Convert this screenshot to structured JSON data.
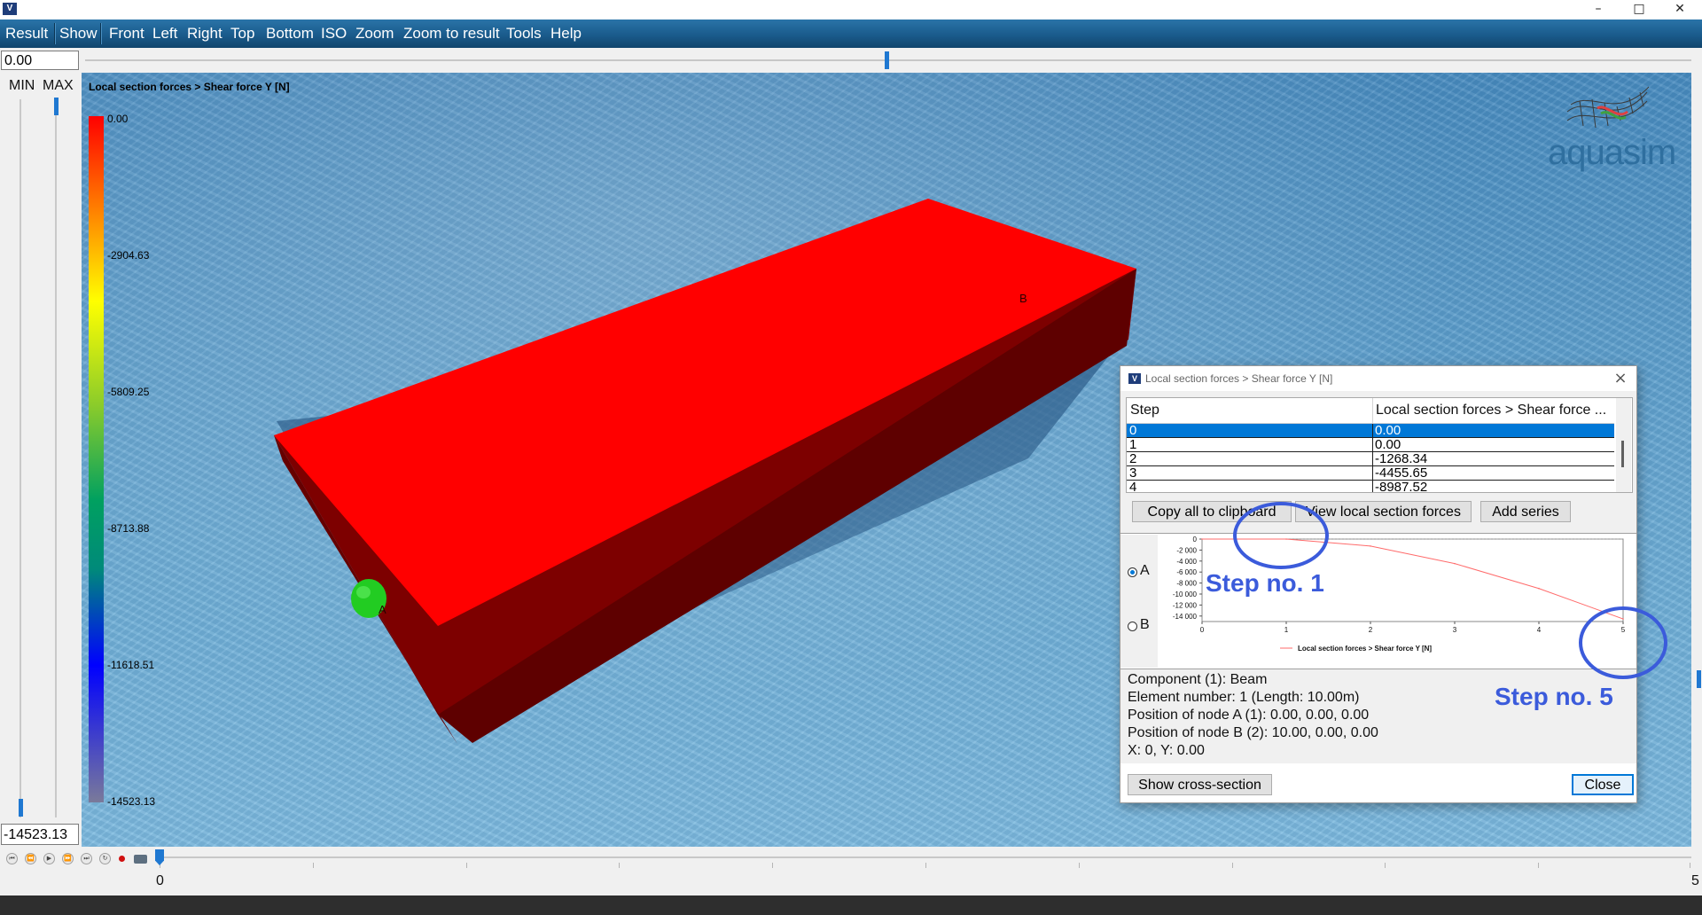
{
  "window": {
    "icon": "aquasim-app-icon",
    "controls": [
      "–",
      "□",
      "✕"
    ]
  },
  "menu": {
    "items": [
      "Result",
      "Show",
      "Front",
      "Left",
      "Right",
      "Top",
      "Bottom",
      "ISO",
      "Zoom",
      "Zoom to result",
      "Tools",
      "Help"
    ]
  },
  "step_value": "0.00",
  "range": {
    "min_label": "MIN",
    "max_label": "MAX",
    "min_value": "-14523.13"
  },
  "legend": {
    "title": "Local section forces > Shear force Y [N]",
    "labels": [
      "0.00",
      "-2904.63",
      "-5809.25",
      "-8713.88",
      "-11618.51",
      "-14523.13"
    ]
  },
  "logo": {
    "text": "aquasim",
    "icon": "aquasim-mesh-logo-icon"
  },
  "scene": {
    "node_a": "A",
    "node_b": "B",
    "beam_color": "#ff0000"
  },
  "timeline": {
    "start": "0",
    "end": "5",
    "controls": [
      "first-icon",
      "prev-icon",
      "play-icon",
      "next-icon",
      "last-icon",
      "loop-icon",
      "record-icon",
      "camera-icon"
    ]
  },
  "dialog": {
    "title": "Local section forces > Shear force Y [N]",
    "table": {
      "headers": [
        "Step",
        "Local section forces > Shear force ..."
      ],
      "rows": [
        [
          "0",
          "0.00"
        ],
        [
          "1",
          "0.00"
        ],
        [
          "2",
          "-1268.34"
        ],
        [
          "3",
          "-4455.65"
        ],
        [
          "4",
          "-8987.52"
        ]
      ]
    },
    "buttons": {
      "copy": "Copy all to clipboard",
      "view": "View local section forces",
      "add": "Add series",
      "cross": "Show cross-section",
      "close": "Close"
    },
    "radios": {
      "a": "A",
      "b": "B"
    },
    "info": [
      "Component (1): Beam",
      "Element number: 1 (Length: 10.00m)",
      "Position of node A (1): 0.00, 0.00, 0.00",
      "Position of node B (2): 10.00, 0.00, 0.00",
      "X: 0, Y: 0.00"
    ]
  },
  "annotations": {
    "step1": "Step no. 1",
    "step5": "Step no. 5",
    "color": "#3b5bdb"
  },
  "chart_data": {
    "type": "line",
    "x": [
      0,
      1,
      2,
      3,
      4,
      5
    ],
    "series": [
      {
        "name": "Local section forces > Shear force Y [N]",
        "values": [
          0,
          0,
          -1268.34,
          -4455.65,
          -8987.52,
          -14523.13
        ],
        "color": "#ff6b6b"
      }
    ],
    "xticks": [
      "0",
      "1",
      "2",
      "3",
      "4",
      "5"
    ],
    "yticks": [
      "0",
      "-2 000",
      "-4 000",
      "-6 000",
      "-8 000",
      "-10 000",
      "-12 000",
      "-14 000"
    ],
    "xlim": [
      0,
      5
    ],
    "ylim": [
      -15000,
      0
    ],
    "legend_position": "bottom",
    "grid": false
  }
}
